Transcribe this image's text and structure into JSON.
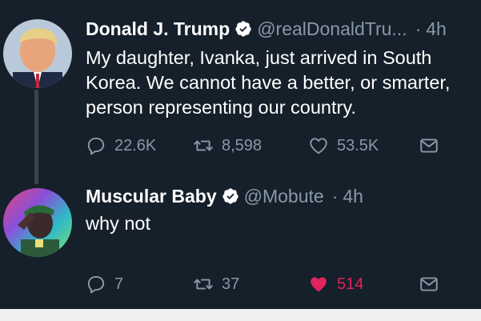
{
  "tweets": [
    {
      "display_name": "Donald J. Trump",
      "verified": true,
      "handle": "@realDonaldTru...",
      "separator": "·",
      "time": "4h",
      "text_lines": [
        "My daughter, Ivanka, just arrived in South",
        "Korea. We cannot have a better, or smarter,",
        "person representing our country."
      ],
      "replies": "22.6K",
      "retweets": "8,598",
      "likes": "53.5K",
      "liked": false
    },
    {
      "display_name": "Muscular Baby",
      "verified": true,
      "handle": "@Mobute",
      "separator": "·",
      "time": "4h",
      "text_lines": [
        "why not"
      ],
      "replies": "7",
      "retweets": "37",
      "likes": "514",
      "liked": true
    }
  ],
  "icons": {
    "reply": "reply-icon",
    "retweet": "retweet-icon",
    "like": "heart-icon",
    "dm": "direct-message-icon",
    "verified": "verified-badge-icon"
  },
  "colors": {
    "background": "#15202b",
    "text": "#ffffff",
    "secondary": "#8899a6",
    "like_active": "#e0245e",
    "thread_line": "#38444d"
  }
}
